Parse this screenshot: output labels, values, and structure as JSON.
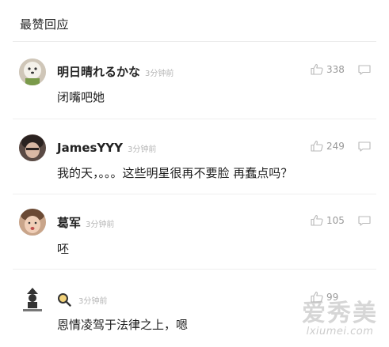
{
  "section": {
    "title": "最赞回应"
  },
  "comments": [
    {
      "name": "明日晴れるかな",
      "time": "3分钟前",
      "likes": "338",
      "text": "闭嘴吧她"
    },
    {
      "name": "JamesYYY",
      "time": "3分钟前",
      "likes": "249",
      "text": "我的天，。。。这些明星很再不要脸 再蠢点吗？"
    },
    {
      "name": "葛军",
      "time": "3分钟前",
      "likes": "105",
      "text": "呸"
    },
    {
      "name": "",
      "time": "3分钟前",
      "likes": "99",
      "text": "恩情凌驾于法律之上，嗯"
    }
  ],
  "watermark": {
    "main": "爱秀美",
    "sub": "lxiumei.com"
  },
  "colors": {
    "meta_gray": "#b5b5b5",
    "icon_gray": "#b8b8b8"
  }
}
